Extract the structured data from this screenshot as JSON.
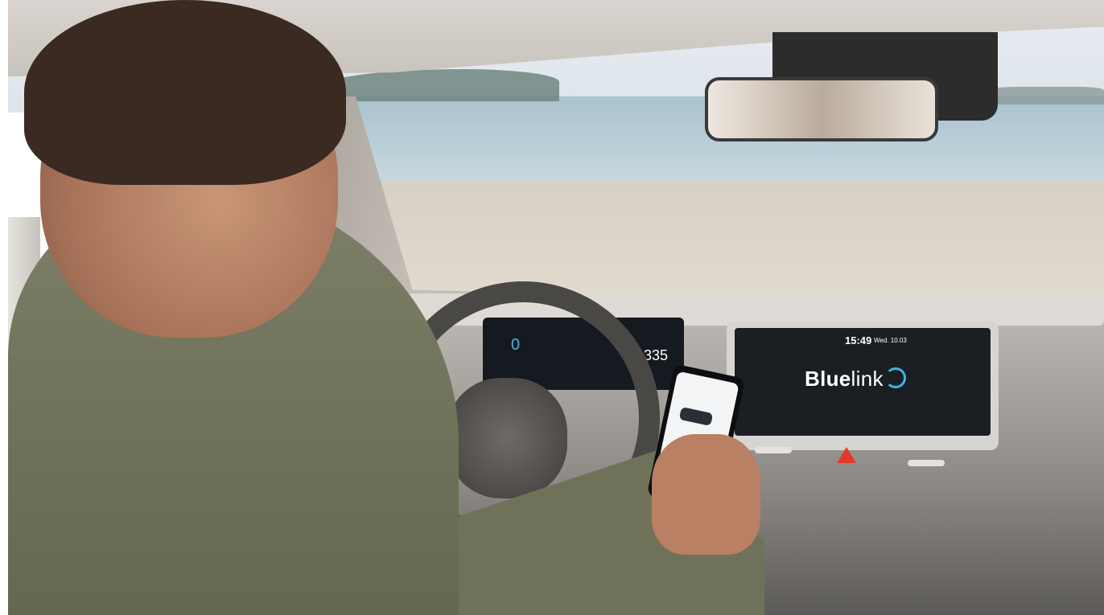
{
  "screen": {
    "time": "15:49",
    "date": "Wed. 10.03",
    "logo_bold": "Blue",
    "logo_light": "link"
  },
  "cluster": {
    "speed": "0",
    "range": "335"
  },
  "colors": {
    "brand_accent": "#3ab7e3",
    "hazard": "#e23a2c"
  }
}
